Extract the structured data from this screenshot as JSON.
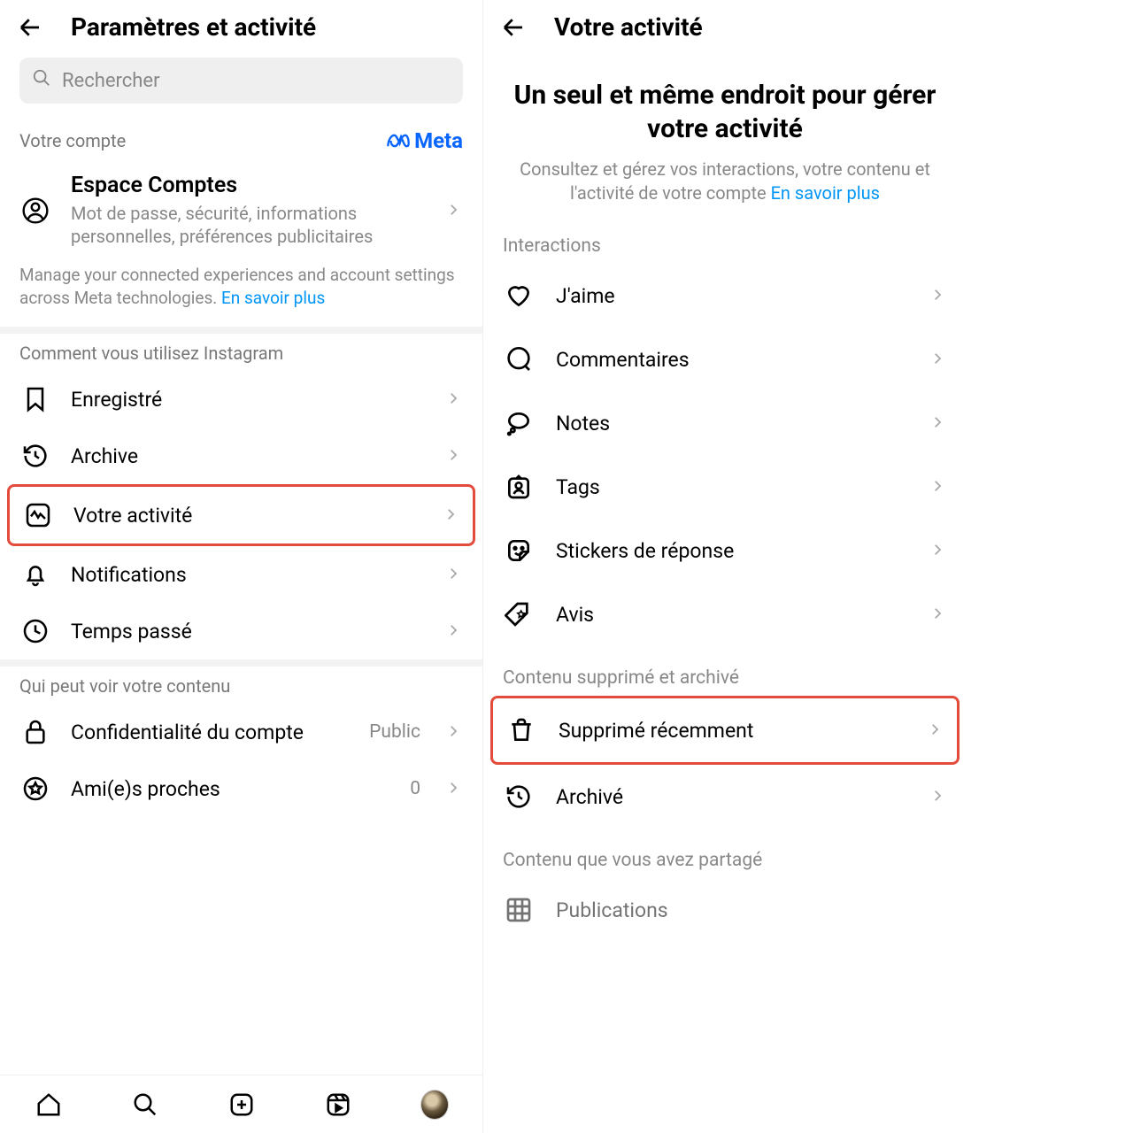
{
  "left": {
    "title": "Paramètres et activité",
    "search_placeholder": "Rechercher",
    "account_section": "Votre compte",
    "meta_brand": "Meta",
    "accounts": {
      "title": "Espace Comptes",
      "sub": "Mot de passe, sécurité, informations personnelles, préférences publicitaires"
    },
    "footnote_text": "Manage your connected experiences and account settings across Meta technologies. ",
    "footnote_link": "En savoir plus",
    "usage_section": "Comment vous utilisez Instagram",
    "items_usage": [
      {
        "label": "Enregistré"
      },
      {
        "label": "Archive"
      },
      {
        "label": "Votre activité"
      },
      {
        "label": "Notifications"
      },
      {
        "label": "Temps passé"
      }
    ],
    "visibility_section": "Qui peut voir votre contenu",
    "items_visibility": [
      {
        "label": "Confidentialité du compte",
        "meta": "Public"
      },
      {
        "label": "Ami(e)s proches",
        "meta": "0"
      }
    ]
  },
  "right": {
    "title": "Votre activité",
    "hero_title": "Un seul et même endroit pour gérer votre activité",
    "hero_sub": "Consultez et gérez vos interactions, votre contenu et l'activité de votre compte ",
    "hero_link": "En savoir plus",
    "sect_interactions": "Interactions",
    "interactions": [
      {
        "label": "J'aime"
      },
      {
        "label": "Commentaires"
      },
      {
        "label": "Notes"
      },
      {
        "label": "Tags"
      },
      {
        "label": "Stickers de réponse"
      },
      {
        "label": "Avis"
      }
    ],
    "sect_deleted": "Contenu supprimé et archivé",
    "deleted_items": [
      {
        "label": "Supprimé récemment"
      },
      {
        "label": "Archivé"
      }
    ],
    "sect_shared": "Contenu que vous avez partagé",
    "shared_first": "Publications"
  }
}
